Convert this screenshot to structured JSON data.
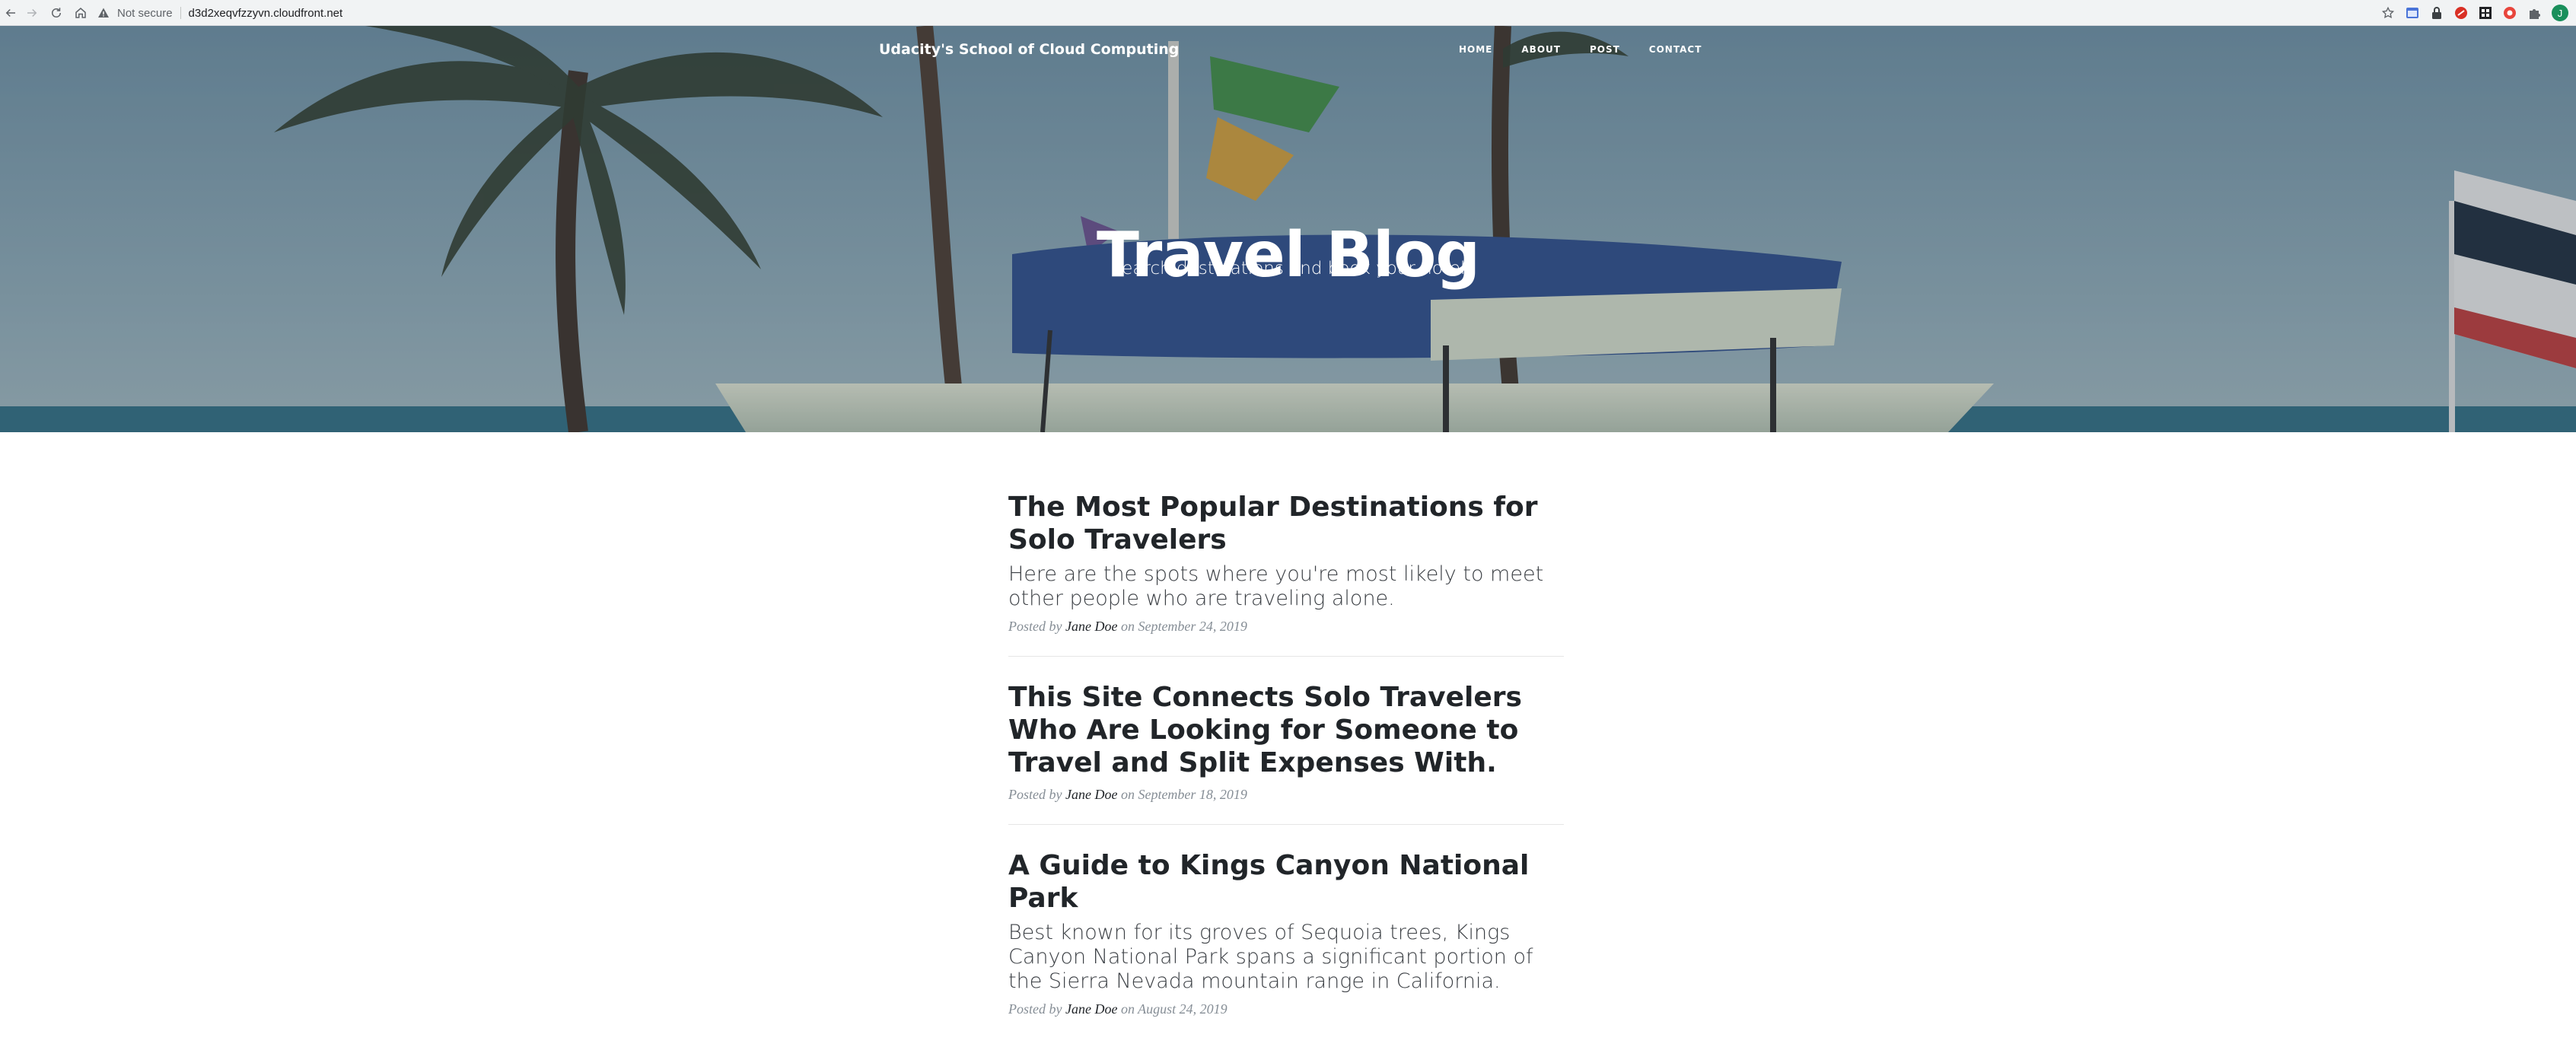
{
  "browser": {
    "security_label": "Not secure",
    "url": "d3d2xeqvfzzyvn.cloudfront.net",
    "profile_initial": "J",
    "toolbar_icons": [
      "back-icon",
      "forward-icon",
      "reload-icon",
      "home-icon",
      "warning-icon",
      "star-icon",
      "extensions-icon"
    ]
  },
  "site": {
    "brand": "Udacity's School of Cloud Computing",
    "nav": [
      {
        "label": "HOME"
      },
      {
        "label": "ABOUT"
      },
      {
        "label": "POST"
      },
      {
        "label": "CONTACT"
      }
    ],
    "hero_title": "Travel Blog",
    "hero_subtitle": "Search destinations and book your hotel"
  },
  "posts": [
    {
      "title": "The Most Popular Destinations for Solo Travelers",
      "subtitle": "Here are the spots where you're most likely to meet other people who are traveling alone.",
      "posted_by": "Posted by",
      "author": "Jane Doe",
      "date": "on September 24, 2019"
    },
    {
      "title": "This Site Connects Solo Travelers Who Are Looking for Someone to Travel and Split Expenses With.",
      "subtitle": "",
      "posted_by": "Posted by",
      "author": "Jane Doe",
      "date": "on September 18, 2019"
    },
    {
      "title": "A Guide to Kings Canyon National Park",
      "subtitle": "Best known for its groves of Sequoia trees, Kings Canyon National Park spans a significant portion of the Sierra Nevada mountain range in California.",
      "posted_by": "Posted by",
      "author": "Jane Doe",
      "date": "on August 24, 2019"
    }
  ]
}
